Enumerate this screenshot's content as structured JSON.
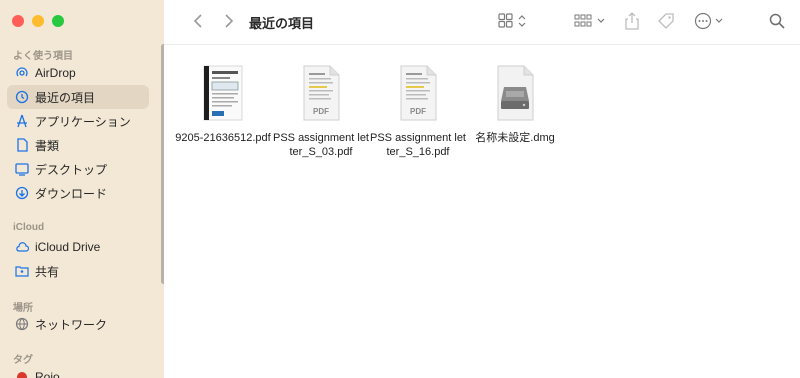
{
  "window": {
    "title": "最近の項目"
  },
  "sidebar": {
    "sections": [
      {
        "title": "よく使う項目",
        "items": [
          {
            "label": "AirDrop",
            "icon": "airdrop-icon"
          },
          {
            "label": "最近の項目",
            "icon": "clock-icon",
            "selected": true
          },
          {
            "label": "アプリケーション",
            "icon": "applications-icon"
          },
          {
            "label": "書類",
            "icon": "document-icon"
          },
          {
            "label": "デスクトップ",
            "icon": "desktop-icon"
          },
          {
            "label": "ダウンロード",
            "icon": "download-icon"
          }
        ]
      },
      {
        "title": "iCloud",
        "items": [
          {
            "label": "iCloud Drive",
            "icon": "cloud-icon"
          },
          {
            "label": "共有",
            "icon": "shared-folder-icon"
          }
        ]
      },
      {
        "title": "場所",
        "items": [
          {
            "label": "ネットワーク",
            "icon": "network-icon"
          }
        ]
      },
      {
        "title": "タグ",
        "items": [
          {
            "label": "Rojo",
            "icon": "red-tag-icon"
          }
        ]
      }
    ]
  },
  "files": [
    {
      "name": "9205-21636512.pdf",
      "type": "scan-pdf"
    },
    {
      "name": "PSS assignment letter_S_03.pdf",
      "type": "pdf",
      "badge": "PDF"
    },
    {
      "name": "PSS assignment letter_S_16.pdf",
      "type": "pdf",
      "badge": "PDF"
    },
    {
      "name": "名称未設定.dmg",
      "type": "dmg"
    }
  ],
  "colors": {
    "sidebar_bg": "#f3e8d6",
    "selected": "#e3d6c2",
    "accent": "#1a73e8",
    "tag_red": "#d93a2b"
  }
}
